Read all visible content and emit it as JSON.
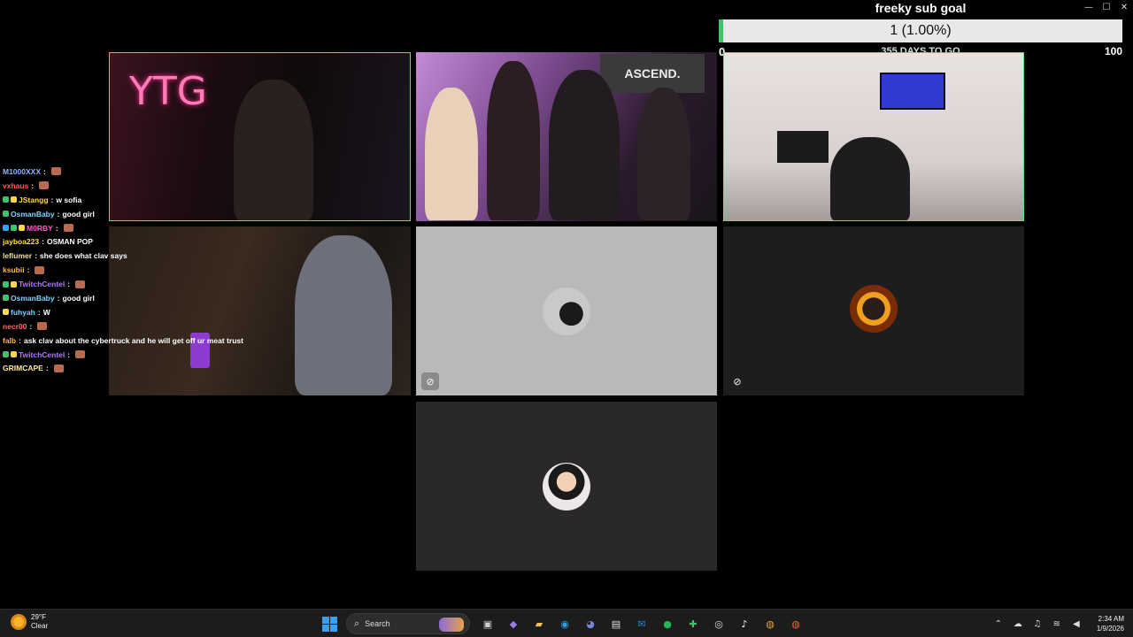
{
  "window": {
    "minimize_glyph": "—",
    "maximize_glyph": "☐",
    "close_glyph": "✕"
  },
  "sub_goal": {
    "title": "freeky sub goal",
    "progress_text": "1 (1.00%)",
    "progress_fraction": 0.01,
    "min_label": "0",
    "max_label": "100",
    "days_text": "355 DAYS TO GO",
    "bar_color": "#3ec26c"
  },
  "tiles": [
    {
      "name": "stream-ytg",
      "neon_text": "YTG",
      "border_color": "#5fe37e"
    },
    {
      "name": "stream-ascend",
      "banner_text": "ASCEND."
    },
    {
      "name": "stream-room",
      "border_color": "#5fe37e"
    },
    {
      "name": "stream-dark-room"
    },
    {
      "name": "participant-avatar-1",
      "icon": "mic-muted-icon"
    },
    {
      "name": "participant-avatar-2",
      "icon": "camera-off-icon"
    },
    {
      "name": "participant-avatar-3"
    }
  ],
  "chat": {
    "messages": [
      {
        "user": "M1000XXX",
        "color": "#8fb8ff",
        "badges": [],
        "text": "",
        "emote": true
      },
      {
        "user": "vxhaus",
        "color": "#ff5a5a",
        "badges": [],
        "text": "",
        "emote": true
      },
      {
        "user": "JStangg",
        "color": "#ffd84a",
        "badges": [
          "#3ec26c",
          "#ffd84a"
        ],
        "text": "w sofia",
        "emote": false
      },
      {
        "user": "OsmanBaby",
        "color": "#7fd3ff",
        "badges": [
          "#3ec26c"
        ],
        "text": "good girl",
        "emote": false
      },
      {
        "user": "M0RBY",
        "color": "#ff5ac8",
        "badges": [
          "#3aa0f0",
          "#3ec26c",
          "#ffd84a"
        ],
        "text": "",
        "emote": true
      },
      {
        "user": "jayboa223",
        "color": "#ffe04a",
        "badges": [],
        "text": "OSMAN POP",
        "emote": false
      },
      {
        "user": "leflumer",
        "color": "#f0e0a0",
        "badges": [],
        "text": "she does what clav says",
        "emote": false
      },
      {
        "user": "ksubii",
        "color": "#ffb84a",
        "badges": [],
        "text": "",
        "emote": true
      },
      {
        "user": "TwitchCentel",
        "color": "#b07cff",
        "badges": [
          "#3ec26c",
          "#ffd84a"
        ],
        "text": "",
        "emote": true
      },
      {
        "user": "OsmanBaby",
        "color": "#7fd3ff",
        "badges": [
          "#3ec26c"
        ],
        "text": "good girl",
        "emote": false
      },
      {
        "user": "fuhyah",
        "color": "#7fd3ff",
        "badges": [
          "#ffd84a"
        ],
        "text": "W",
        "emote": false
      },
      {
        "user": "necr00",
        "color": "#ff6a6a",
        "badges": [],
        "text": "",
        "emote": true
      },
      {
        "user": "falb",
        "color": "#ffb84a",
        "badges": [],
        "text": "ask clav about the cybertruck and he will get off ur meat trust",
        "emote": false
      },
      {
        "user": "TwitchCentel",
        "color": "#b07cff",
        "badges": [
          "#3ec26c",
          "#ffd84a"
        ],
        "text": "",
        "emote": true
      },
      {
        "user": "GRIMCAPE",
        "color": "#ffe8a0",
        "badges": [],
        "text": "",
        "emote": true
      }
    ]
  },
  "taskbar": {
    "weather_temp": "29°F",
    "weather_desc": "Clear",
    "search_label": "Search",
    "time": "2:34 AM",
    "date": "1/9/2026",
    "apps": [
      {
        "name": "task-view-icon",
        "glyph": "▣",
        "color": "#cfcfcf"
      },
      {
        "name": "copilot-icon",
        "glyph": "◆",
        "color": "#9b7cf0"
      },
      {
        "name": "file-explorer-icon",
        "glyph": "▰",
        "color": "#f2c14e"
      },
      {
        "name": "edge-icon",
        "glyph": "◉",
        "color": "#29a3e8"
      },
      {
        "name": "discord-icon",
        "glyph": "◕",
        "color": "#7289da"
      },
      {
        "name": "store-icon",
        "glyph": "▤",
        "color": "#e0e0e0"
      },
      {
        "name": "outlook-icon",
        "glyph": "✉",
        "color": "#2d7fd8"
      },
      {
        "name": "spotify-icon",
        "glyph": "●",
        "color": "#1db954"
      },
      {
        "name": "app-icon-1",
        "glyph": "✚",
        "color": "#3ec26c"
      },
      {
        "name": "obs-icon",
        "glyph": "◎",
        "color": "#dddddd"
      },
      {
        "name": "tiktok-icon",
        "glyph": "♪",
        "color": "#ffffff"
      },
      {
        "name": "chrome-icon",
        "glyph": "◍",
        "color": "#e8a23a"
      },
      {
        "name": "chrome-icon-2",
        "glyph": "◍",
        "color": "#e06b3a"
      }
    ],
    "tray": [
      {
        "name": "chevron-up-icon",
        "glyph": "⌃"
      },
      {
        "name": "cloud-icon",
        "glyph": "☁"
      },
      {
        "name": "microphone-icon",
        "glyph": "♫"
      },
      {
        "name": "wifi-icon",
        "glyph": "≋"
      },
      {
        "name": "volume-icon",
        "glyph": "◀"
      }
    ]
  }
}
